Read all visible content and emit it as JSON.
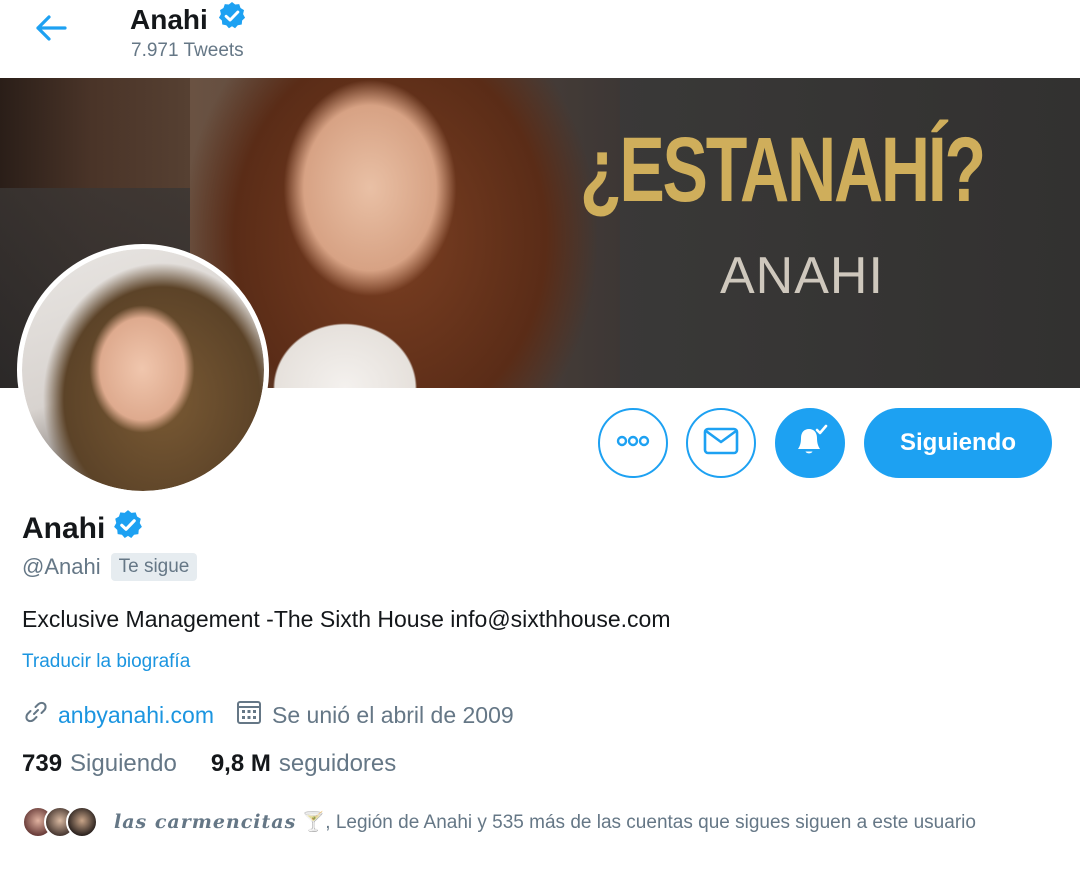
{
  "header": {
    "name": "Anahi",
    "tweet_count": "7.971 Tweets"
  },
  "banner": {
    "title": "¿ESTANAHÍ?",
    "subtitle": "ANAHI"
  },
  "actions": {
    "follow_label": "Siguiendo"
  },
  "profile": {
    "name": "Anahi",
    "handle": "@Anahi",
    "follows_you": "Te sigue",
    "bio": "Exclusive Management -The Sixth House info@sixthhouse.com",
    "translate_label": "Traducir la biografía",
    "website": "anbyanahi.com",
    "joined": "Se unió el abril de 2009"
  },
  "stats": {
    "following_count": "739",
    "following_label": "Siguiendo",
    "followers_count": "9,8 M",
    "followers_label": "seguidores"
  },
  "followed_by": {
    "first_name": "las carmencitas",
    "emoji": "🍸",
    "rest": ", Legión de Anahi y 535 más de las cuentas que sigues siguen a este usuario"
  },
  "colors": {
    "accent": "#1da1f2",
    "link": "#1b95e0",
    "secondary_text": "#657786",
    "banner_gold": "#cfae5b"
  }
}
